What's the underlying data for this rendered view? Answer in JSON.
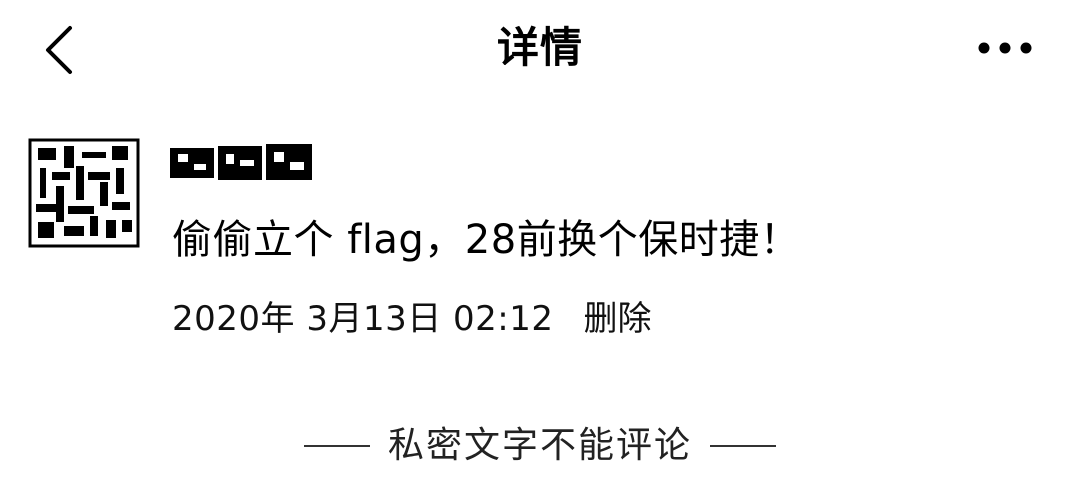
{
  "header": {
    "title": "详情",
    "back_icon": "chevron-left-icon",
    "more_icon": "more-horizontal-icon"
  },
  "post": {
    "avatar_icon": "avatar-qr-pattern",
    "author_name": "",
    "content": "偷偷立个 flag，28前换个保时捷！",
    "timestamp": "2020年 3月13日 02:12",
    "delete_label": "删除"
  },
  "footer": {
    "note": "私密文字不能评论"
  }
}
